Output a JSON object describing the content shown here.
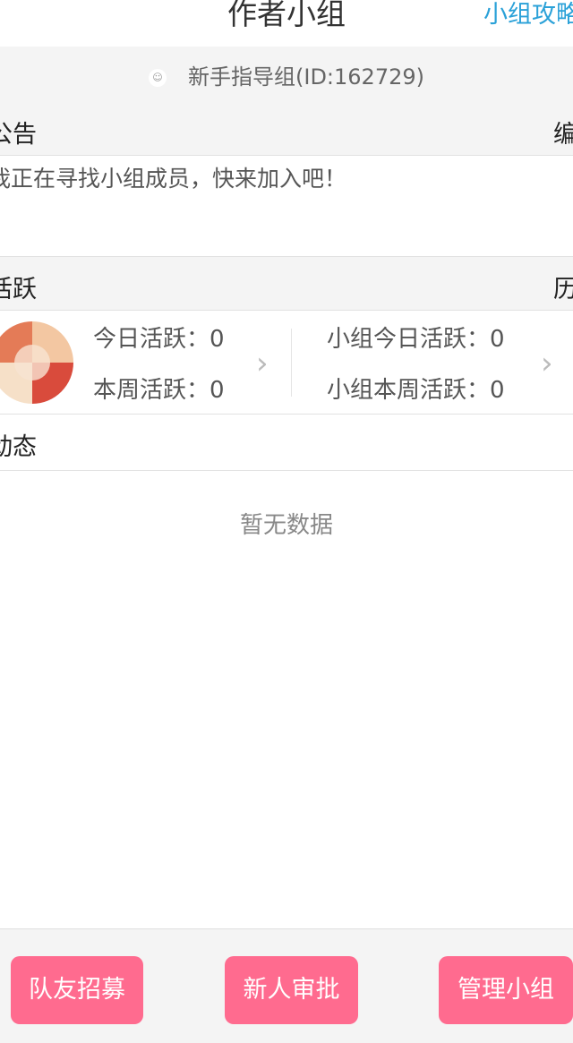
{
  "header": {
    "title": "作者小组",
    "guide_link": "小组攻略"
  },
  "group": {
    "name_id": "新手指导组(ID:162729)",
    "icon": "group-icon"
  },
  "announcement": {
    "label": "公告",
    "edit_label": "编辑",
    "text": "我正在寻找小组成员，快来加入吧！"
  },
  "activity": {
    "label": "活跃",
    "history_label": "历史",
    "today_personal": "今日活跃：0",
    "week_personal": "本周活跃：0",
    "today_group": "小组今日活跃：0",
    "week_group": "小组本周活跃：0"
  },
  "feed": {
    "label": "动态",
    "empty_text": "暂无数据"
  },
  "footer": {
    "recruit_label": "队友招募",
    "approve_label": "新人审批",
    "manage_label": "管理小组"
  },
  "colors": {
    "accent_button": "#ff6b8f",
    "link": "#2aa1d8"
  }
}
